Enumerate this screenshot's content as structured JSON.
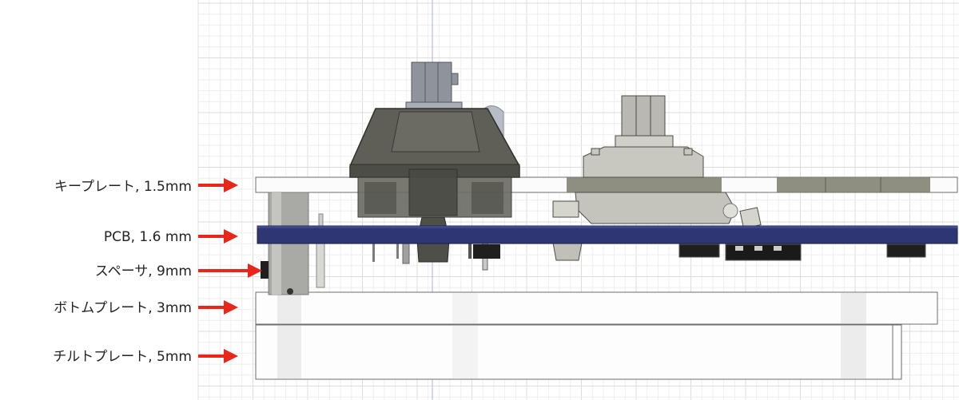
{
  "layers": [
    {
      "id": "key-plate",
      "label": "キープレート, 1.5mm"
    },
    {
      "id": "pcb",
      "label": "PCB, 1.6 mm"
    },
    {
      "id": "spacer",
      "label": "スペーサ, 9mm"
    },
    {
      "id": "bottom-plate",
      "label": "ボトムプレート, 3mm"
    },
    {
      "id": "tilt-plate",
      "label": "チルトプレート, 5mm"
    }
  ],
  "colors": {
    "arrow": "#e8261a",
    "pcb": "#2f3773",
    "switch_body": "#5f5f58",
    "switch_light": "#b9b8b1",
    "stem": "#8e939c",
    "plate_outline": "#6d6d6d",
    "grid_minor": "#eeeeee",
    "grid_major": "#dddddd",
    "axis": "#aab0ee"
  },
  "icons": [
    "arrow-right-icon"
  ]
}
